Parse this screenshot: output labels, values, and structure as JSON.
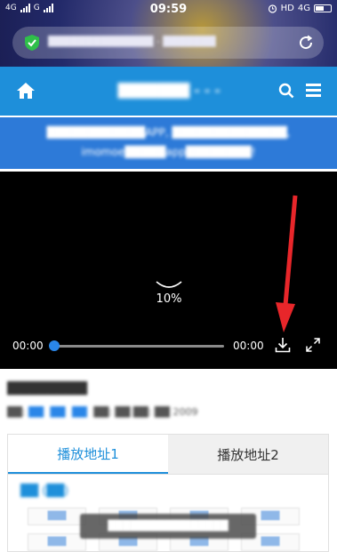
{
  "status_bar": {
    "network_1": "4G",
    "network_2": "G",
    "time": "09:59",
    "hd_label": "HD",
    "network_3": "4G"
  },
  "browser": {
    "url_text": "██████████████ - ███████"
  },
  "site": {
    "title": "███████ - - -",
    "notice_line_1": "████████████APP, ██████████████,",
    "notice_line_2": "imomoe█████app████████!"
  },
  "player": {
    "progress_percent": "10%",
    "time_current": "00:00",
    "time_total": "00:00",
    "progress_fraction": 0.0
  },
  "info": {
    "title": "█████████",
    "meta_label": "██:",
    "meta_tags": [
      "██",
      "██",
      "██"
    ],
    "meta_rest": "██: ██ ██: ██ 2009"
  },
  "tabs": [
    {
      "label": "播放地址1"
    },
    {
      "label": "播放地址2"
    }
  ],
  "episodes": {
    "heading": "██ (██)",
    "items": [
      "███",
      "███",
      "███",
      "███",
      "███",
      "███",
      "███",
      "███",
      "███",
      "███"
    ]
  },
  "toast": {
    "text": "████████████████"
  },
  "colors": {
    "brand_blue": "#1e8fda",
    "banner_blue": "#2d7ad8",
    "arrow_red": "#e8262a",
    "seek_blue": "#2a86e8"
  }
}
